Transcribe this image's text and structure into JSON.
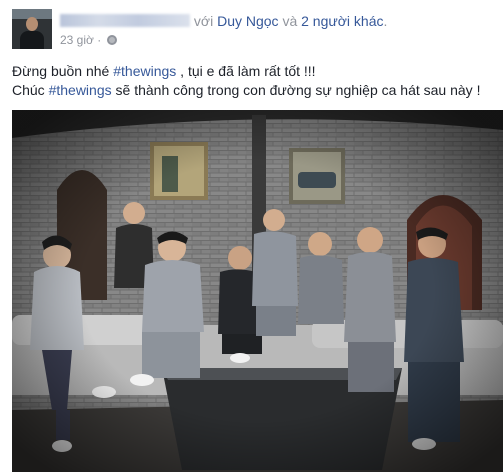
{
  "post": {
    "header": {
      "connector": "với",
      "tagged_friend": "Duy Ngọc",
      "and_text": "và",
      "others": "2 người khác",
      "period": "."
    },
    "meta": {
      "time": "23 giờ",
      "separator": "·",
      "privacy_icon": "globe-icon"
    },
    "caption": {
      "line1_before": "Đừng buồn nhé ",
      "line1_hashtag": "#thewings",
      "line1_after": " , tụi e đã làm rất tốt !!!",
      "line2_before": "Chúc ",
      "line2_hashtag": "#thewings",
      "line2_after": " sẽ thành công trong con đường sự nghiệp ca hát sau này !"
    },
    "photo": {
      "icon": "group-photo"
    }
  },
  "colors": {
    "link": "#365899",
    "muted": "#90949c",
    "text": "#1d2129"
  }
}
